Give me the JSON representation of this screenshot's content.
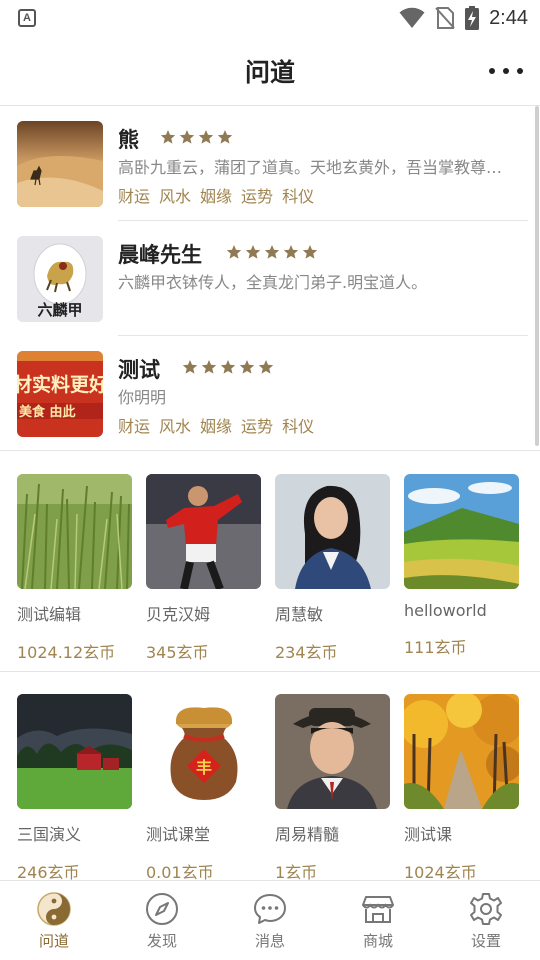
{
  "status_bar": {
    "time": "2:44",
    "app_badge": "A"
  },
  "header": {
    "title": "问道"
  },
  "masters": [
    {
      "name": "熊",
      "stars": 4,
      "desc": "高卧九重云，蒲团了道真。天地玄黄外，吾当掌教尊…",
      "tags": [
        "财运",
        "风水",
        "姻缘",
        "运势",
        "科仪"
      ],
      "avatar": "desert-camel-photo"
    },
    {
      "name": "晨峰先生",
      "stars": 5,
      "desc": "六麟甲衣钵传人，全真龙门弟子.明宝道人。",
      "tags": [],
      "avatar": "liulinjia-logo",
      "avatar_text": "六麟甲"
    },
    {
      "name": "测试",
      "stars": 5,
      "desc": "你明明",
      "tags": [
        "财运",
        "风水",
        "姻缘",
        "运势",
        "科仪"
      ],
      "avatar": "red-banner-image",
      "avatar_text_1": "材实料更好",
      "avatar_text_2": "美食 由此"
    }
  ],
  "products_row1": [
    {
      "title": "测试编辑",
      "price": "1024.12玄币",
      "image": "grass-photo"
    },
    {
      "title": "贝克汉姆",
      "price": "345玄币",
      "image": "footballer-photo"
    },
    {
      "title": "周慧敏",
      "price": "234玄币",
      "image": "portrait-photo"
    },
    {
      "title": "helloworld",
      "price": "111玄币",
      "image": "green-hills-photo"
    }
  ],
  "products_row2": [
    {
      "title": "三国演义",
      "price": "246玄币",
      "image": "red-barn-photo"
    },
    {
      "title": "测试课堂",
      "price": "0.01玄币",
      "image": "grain-sack-image",
      "sack_char": "丰"
    },
    {
      "title": "周易精髓",
      "price": "1玄币",
      "image": "man-hat-portrait"
    },
    {
      "title": "测试课",
      "price": "1024玄币",
      "image": "autumn-road-photo"
    }
  ],
  "tabs": [
    {
      "label": "问道",
      "icon": "yinyang-icon",
      "active": true
    },
    {
      "label": "发现",
      "icon": "compass-icon",
      "active": false
    },
    {
      "label": "消息",
      "icon": "chat-bubble-icon",
      "active": false
    },
    {
      "label": "商城",
      "icon": "store-icon",
      "active": false
    },
    {
      "label": "设置",
      "icon": "gear-icon",
      "active": false
    }
  ],
  "colors": {
    "accent": "#a08550",
    "star": "#8f7a54",
    "tab_active": "#8a6a33",
    "divider": "#e4e4e4"
  }
}
